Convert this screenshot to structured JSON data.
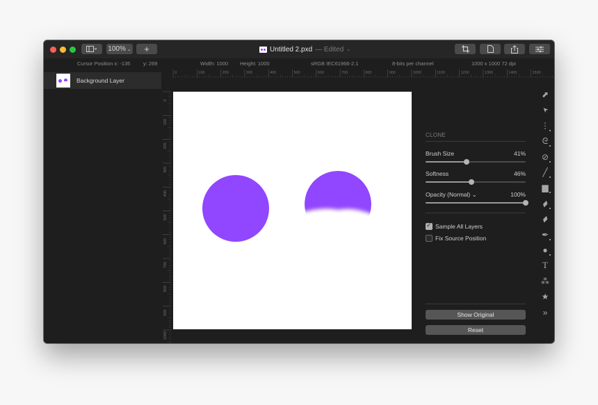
{
  "window": {
    "title": "Untitled 2.pxd",
    "status": "— Edited",
    "zoom_level": "100%",
    "colors": {
      "accent_purple": "#9146ff",
      "traffic_red": "#fe5f57",
      "traffic_yellow": "#febc2e",
      "traffic_green": "#28c840"
    }
  },
  "toolbar": {
    "view_toggle_icon": "sidebar-icon",
    "zoom_label": "100%",
    "add_label": "+",
    "right_buttons": [
      {
        "name": "crop",
        "icon": "crop-icon"
      },
      {
        "name": "document",
        "icon": "document-icon"
      },
      {
        "name": "share",
        "icon": "share-icon"
      },
      {
        "name": "adjustments",
        "icon": "sliders-icon"
      }
    ]
  },
  "infobar": {
    "cursor_x": "Cursor Position x: -135",
    "cursor_y": "y: 269",
    "width": "Width: 1000",
    "height": "Height: 1000",
    "color_profile": "sRGB IEC61966-2.1",
    "bit_depth": "8-bits per channel",
    "resolution": "1000  x 1000 72 dpi"
  },
  "layers": [
    {
      "name": "Background Layer",
      "selected": true
    }
  ],
  "rulers": {
    "top_ticks": [
      "0",
      "100",
      "200",
      "300",
      "400",
      "500",
      "600",
      "700",
      "800",
      "900",
      "1000",
      "1100",
      "1200",
      "1300",
      "1400",
      "1500"
    ],
    "left_ticks": [
      "0",
      "100",
      "200",
      "300",
      "400",
      "500",
      "600",
      "700",
      "800",
      "900",
      "1000"
    ]
  },
  "clone_panel": {
    "title": "CLONE",
    "brush_size": {
      "label": "Brush Size",
      "value": "41%",
      "fraction": 0.41
    },
    "softness": {
      "label": "Softness",
      "value": "46%",
      "fraction": 0.46
    },
    "opacity": {
      "label": "Opacity (Normal) ⌄",
      "value": "100%",
      "fraction": 1.0
    },
    "sample_all_layers": {
      "label": "Sample All Layers",
      "checked": true
    },
    "fix_source_position": {
      "label": "Fix Source Position",
      "checked": false
    },
    "show_original_label": "Show Original",
    "reset_label": "Reset"
  },
  "tools": [
    {
      "name": "arrange",
      "icon": "arrange-icon",
      "glyph": "⬈",
      "more": false
    },
    {
      "name": "move",
      "icon": "pointer-icon",
      "glyph": "➤",
      "more": false
    },
    {
      "name": "select",
      "icon": "marquee-icon",
      "glyph": "⋮",
      "more": true
    },
    {
      "name": "lasso",
      "icon": "lasso-icon",
      "glyph": "ᘓ",
      "more": true
    },
    {
      "name": "color-picker",
      "icon": "eyedropper-icon",
      "glyph": "⊘",
      "more": true
    },
    {
      "name": "brush",
      "icon": "brush-icon",
      "glyph": "╱",
      "more": true
    },
    {
      "name": "paint-bucket",
      "icon": "bucket-icon",
      "glyph": "▆",
      "more": true
    },
    {
      "name": "eraser",
      "icon": "eraser-icon",
      "glyph": "▰",
      "more": true
    },
    {
      "name": "retouch",
      "icon": "bandage-icon",
      "glyph": "▰",
      "more": false
    },
    {
      "name": "pen",
      "icon": "pen-icon",
      "glyph": "✒",
      "more": true
    },
    {
      "name": "shape",
      "icon": "circle-shape-icon",
      "glyph": "●",
      "more": true
    },
    {
      "name": "type",
      "icon": "text-icon",
      "glyph": "T",
      "more": false
    },
    {
      "name": "effects",
      "icon": "effects-icon",
      "glyph": "⁂",
      "more": false
    },
    {
      "name": "favorites",
      "icon": "star-icon",
      "glyph": "★",
      "more": false
    },
    {
      "name": "more-tools",
      "icon": "chevrons-right-icon",
      "glyph": "»",
      "more": false
    }
  ]
}
